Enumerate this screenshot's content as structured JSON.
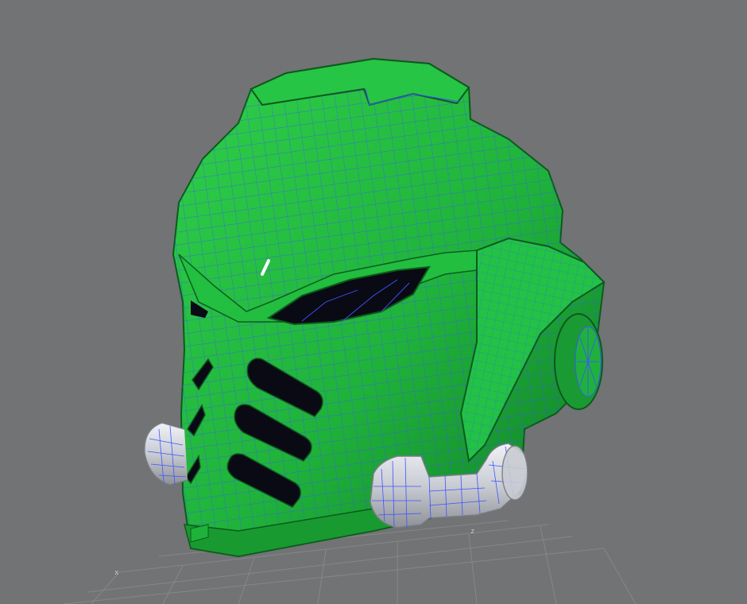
{
  "viewport": {
    "background": "#717375",
    "grid_color": "#8a8c8e",
    "axis_labels": {
      "x": "x",
      "z": "z"
    }
  },
  "model": {
    "name": "space-marine-helmet",
    "shell_color": "#1fb23a",
    "shell_shadow_color": "#0f7a25",
    "wire_color": "#3d55ff",
    "pipe_color": "#cfd2d8",
    "eye_color": "#0a0a14"
  }
}
